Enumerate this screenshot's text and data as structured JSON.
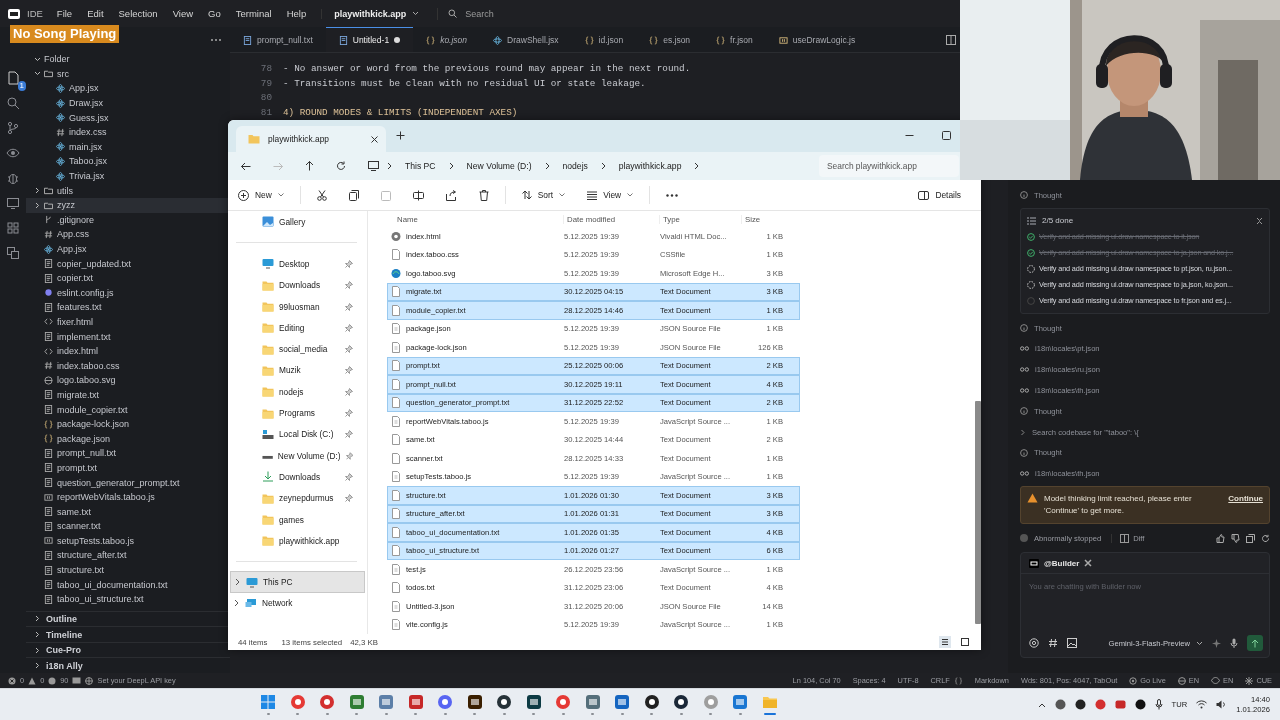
{
  "overlay": {
    "text": "No Song Playing"
  },
  "title_bar": {
    "app": "IDE",
    "menus": [
      "File",
      "Edit",
      "Selection",
      "View",
      "Go",
      "Terminal",
      "Help"
    ],
    "project": "playwithkick.app",
    "search": {
      "placeholder": "Search"
    }
  },
  "activity_bar": {
    "badge": "1"
  },
  "sidebar": {
    "tree": [
      {
        "label": "Folder",
        "kind": "root",
        "expanded": true,
        "selected": false,
        "children": [
          {
            "label": "src",
            "kind": "folder",
            "expanded": true,
            "selected": false,
            "children": [
              {
                "label": "App.jsx",
                "kind": "jsx",
                "selected": false
              },
              {
                "label": "Draw.jsx",
                "kind": "jsx",
                "selected": false
              },
              {
                "label": "Guess.jsx",
                "kind": "jsx",
                "selected": false
              },
              {
                "label": "index.css",
                "kind": "css",
                "selected": false
              },
              {
                "label": "main.jsx",
                "kind": "jsx",
                "selected": false
              },
              {
                "label": "Taboo.jsx",
                "kind": "jsx",
                "selected": false
              },
              {
                "label": "Trivia.jsx",
                "kind": "jsx",
                "selected": false
              }
            ]
          },
          {
            "label": "utils",
            "kind": "folder",
            "expanded": false,
            "selected": false
          },
          {
            "label": "zyzz",
            "kind": "folder",
            "expanded": false,
            "selected": true
          },
          {
            "label": ".gitignore",
            "kind": "git",
            "selected": false
          },
          {
            "label": "App.css",
            "kind": "css",
            "selected": false
          },
          {
            "label": "App.jsx",
            "kind": "jsx",
            "selected": false
          },
          {
            "label": "copier_updated.txt",
            "kind": "txt",
            "selected": false
          },
          {
            "label": "copier.txt",
            "kind": "txt",
            "selected": false
          },
          {
            "label": "eslint.config.js",
            "kind": "eslint",
            "selected": false
          },
          {
            "label": "features.txt",
            "kind": "txt",
            "selected": false
          },
          {
            "label": "fixer.html",
            "kind": "html",
            "selected": false
          },
          {
            "label": "implement.txt",
            "kind": "txt",
            "selected": false
          },
          {
            "label": "index.html",
            "kind": "html",
            "selected": false
          },
          {
            "label": "index.taboo.css",
            "kind": "css",
            "selected": false
          },
          {
            "label": "logo.taboo.svg",
            "kind": "svg",
            "selected": false
          },
          {
            "label": "migrate.txt",
            "kind": "txt",
            "selected": false
          },
          {
            "label": "module_copier.txt",
            "kind": "txt",
            "selected": false
          },
          {
            "label": "package-lock.json",
            "kind": "json",
            "selected": false
          },
          {
            "label": "package.json",
            "kind": "json",
            "selected": false
          },
          {
            "label": "prompt_null.txt",
            "kind": "txt",
            "selected": false
          },
          {
            "label": "prompt.txt",
            "kind": "txt",
            "selected": false
          },
          {
            "label": "question_generator_prompt.txt",
            "kind": "txt",
            "selected": false
          },
          {
            "label": "reportWebVitals.taboo.js",
            "kind": "js",
            "selected": false
          },
          {
            "label": "same.txt",
            "kind": "txt",
            "selected": false
          },
          {
            "label": "scanner.txt",
            "kind": "txt",
            "selected": false
          },
          {
            "label": "setupTests.taboo.js",
            "kind": "js",
            "selected": false
          },
          {
            "label": "structure_after.txt",
            "kind": "txt",
            "selected": false
          },
          {
            "label": "structure.txt",
            "kind": "txt",
            "selected": false
          },
          {
            "label": "taboo_ui_documentation.txt",
            "kind": "txt",
            "selected": false
          },
          {
            "label": "taboo_ui_structure.txt",
            "kind": "txt",
            "selected": false
          }
        ]
      }
    ],
    "sections": [
      "Outline",
      "Timeline",
      "Cue-Pro",
      "i18n Ally"
    ]
  },
  "editor": {
    "tabs": [
      {
        "label": "prompt_null.txt",
        "selected": false,
        "preview": false,
        "modified": false,
        "kind": "txt"
      },
      {
        "label": "Untitled-1",
        "selected": true,
        "preview": false,
        "modified": true,
        "kind": "txt"
      },
      {
        "label": "ko.json",
        "selected": false,
        "preview": true,
        "modified": false,
        "kind": "json"
      },
      {
        "label": "DrawShell.jsx",
        "selected": false,
        "preview": false,
        "modified": false,
        "kind": "jsx"
      },
      {
        "label": "id.json",
        "selected": false,
        "preview": false,
        "modified": false,
        "kind": "json"
      },
      {
        "label": "es.json",
        "selected": false,
        "preview": false,
        "modified": false,
        "kind": "json"
      },
      {
        "label": "fr.json",
        "selected": false,
        "preview": false,
        "modified": false,
        "kind": "json"
      },
      {
        "label": "useDrawLogic.js",
        "selected": false,
        "preview": false,
        "modified": false,
        "kind": "js"
      }
    ],
    "lines": [
      {
        "number": "78",
        "text": "- No answer or word from the previous round may appear in the next round.",
        "kind": "list"
      },
      {
        "number": "79",
        "text": "- Transitions must be clean with no residual UI or state leakage.",
        "kind": "list"
      },
      {
        "number": "80"
      },
      {
        "number": "81",
        "text": "4) ROUND MODES & LIMITS (INDEPENDENT AXES)",
        "kind": "heading"
      }
    ]
  },
  "explorer_window": {
    "tab_title": "playwithkick.app",
    "breadcrumb": [
      "This PC",
      "New Volume (D:)",
      "nodejs",
      "playwithkick.app"
    ],
    "search": {
      "placeholder": "Search playwithkick.app"
    },
    "toolbar": {
      "new": "New",
      "sort": "Sort",
      "view": "View",
      "details": "Details"
    },
    "nav_top": [
      {
        "label": "Gallery",
        "kind": "gallery",
        "pinned": false,
        "selected": false
      }
    ],
    "quick_access": [
      {
        "label": "Desktop",
        "kind": "desktop",
        "pinned": true,
        "selected": false
      },
      {
        "label": "Downloads",
        "kind": "folder",
        "pinned": true,
        "selected": false
      },
      {
        "label": "99luosman",
        "kind": "folder",
        "pinned": true,
        "selected": false
      },
      {
        "label": "Editing",
        "kind": "folder",
        "pinned": true,
        "selected": false
      },
      {
        "label": "social_media",
        "kind": "folder",
        "pinned": true,
        "selected": false
      },
      {
        "label": "Muzik",
        "kind": "folder",
        "pinned": true,
        "selected": false
      },
      {
        "label": "nodejs",
        "kind": "folder",
        "pinned": true,
        "selected": false
      },
      {
        "label": "Programs",
        "kind": "folder",
        "pinned": true,
        "selected": false
      },
      {
        "label": "Local Disk (C:)",
        "kind": "system_drive",
        "pinned": true,
        "selected": false
      },
      {
        "label": "New Volume (D:)",
        "kind": "drive",
        "pinned": true,
        "selected": false
      },
      {
        "label": "Downloads",
        "kind": "download",
        "pinned": true,
        "selected": false
      },
      {
        "label": "zeynepdurmus",
        "kind": "folder",
        "pinned": true,
        "selected": false
      },
      {
        "label": "games",
        "kind": "folder",
        "pinned": false,
        "selected": false
      },
      {
        "label": "playwithkick.app",
        "kind": "folder",
        "pinned": false,
        "selected": false
      }
    ],
    "locations": [
      {
        "label": "This PC",
        "kind": "pc",
        "pinned": false,
        "selected": true
      },
      {
        "label": "Network",
        "kind": "network",
        "pinned": false,
        "selected": false
      }
    ],
    "columns": [
      "Name",
      "Date modified",
      "Type",
      "Size"
    ],
    "rows": [
      {
        "name": "index.html",
        "date": "5.12.2025 19:39",
        "type": "Vivaldi HTML Doc...",
        "size": "1 KB",
        "kind": "html",
        "selected": false
      },
      {
        "name": "index.taboo.css",
        "date": "5.12.2025 19:39",
        "type": "CSSfile",
        "size": "1 KB",
        "kind": "plain",
        "selected": false
      },
      {
        "name": "logo.taboo.svg",
        "date": "5.12.2025 19:39",
        "type": "Microsoft Edge H...",
        "size": "3 KB",
        "kind": "svg",
        "selected": false
      },
      {
        "name": "migrate.txt",
        "date": "30.12.2025 04:15",
        "type": "Text Document",
        "size": "3 KB",
        "kind": "txt",
        "selected": true
      },
      {
        "name": "module_copier.txt",
        "date": "28.12.2025 14:46",
        "type": "Text Document",
        "size": "1 KB",
        "kind": "txt",
        "selected": true
      },
      {
        "name": "package.json",
        "date": "5.12.2025 19:39",
        "type": "JSON Source File",
        "size": "1 KB",
        "kind": "code",
        "selected": false
      },
      {
        "name": "package-lock.json",
        "date": "5.12.2025 19:39",
        "type": "JSON Source File",
        "size": "126 KB",
        "kind": "code",
        "selected": false
      },
      {
        "name": "prompt.txt",
        "date": "25.12.2025 00:06",
        "type": "Text Document",
        "size": "2 KB",
        "kind": "txt",
        "selected": true
      },
      {
        "name": "prompt_null.txt",
        "date": "30.12.2025 19:11",
        "type": "Text Document",
        "size": "4 KB",
        "kind": "txt",
        "selected": true
      },
      {
        "name": "question_generator_prompt.txt",
        "date": "31.12.2025 22:52",
        "type": "Text Document",
        "size": "2 KB",
        "kind": "txt",
        "selected": true
      },
      {
        "name": "reportWebVitals.taboo.js",
        "date": "5.12.2025 19:39",
        "type": "JavaScript Source ...",
        "size": "1 KB",
        "kind": "code",
        "selected": false
      },
      {
        "name": "same.txt",
        "date": "30.12.2025 14:44",
        "type": "Text Document",
        "size": "2 KB",
        "kind": "txt",
        "selected": false
      },
      {
        "name": "scanner.txt",
        "date": "28.12.2025 14:33",
        "type": "Text Document",
        "size": "1 KB",
        "kind": "txt",
        "selected": false
      },
      {
        "name": "setupTests.taboo.js",
        "date": "5.12.2025 19:39",
        "type": "JavaScript Source ...",
        "size": "1 KB",
        "kind": "code",
        "selected": false
      },
      {
        "name": "structure.txt",
        "date": "1.01.2026 01:30",
        "type": "Text Document",
        "size": "3 KB",
        "kind": "txt",
        "selected": true
      },
      {
        "name": "structure_after.txt",
        "date": "1.01.2026 01:31",
        "type": "Text Document",
        "size": "3 KB",
        "kind": "txt",
        "selected": true
      },
      {
        "name": "taboo_ui_documentation.txt",
        "date": "1.01.2026 01:35",
        "type": "Text Document",
        "size": "4 KB",
        "kind": "txt",
        "selected": true
      },
      {
        "name": "taboo_ui_structure.txt",
        "date": "1.01.2026 01:27",
        "type": "Text Document",
        "size": "6 KB",
        "kind": "txt",
        "selected": true
      },
      {
        "name": "test.js",
        "date": "26.12.2025 23:56",
        "type": "JavaScript Source ...",
        "size": "1 KB",
        "kind": "code",
        "selected": false
      },
      {
        "name": "todos.txt",
        "date": "31.12.2025 23:06",
        "type": "Text Document",
        "size": "4 KB",
        "kind": "txt",
        "selected": false
      },
      {
        "name": "Untitled-3.json",
        "date": "31.12.2025 20:06",
        "type": "JSON Source File",
        "size": "14 KB",
        "kind": "code",
        "selected": false
      },
      {
        "name": "vite.config.js",
        "date": "5.12.2025 19:39",
        "type": "JavaScript Source ...",
        "size": "1 KB",
        "kind": "code",
        "selected": false
      }
    ],
    "status": {
      "count": "44 items",
      "selection": "13 items selected",
      "size": "42,3 KB"
    }
  },
  "chat": {
    "items": [
      {
        "kind": "thought",
        "text": "Thought"
      },
      {
        "kind": "todo",
        "title": "2/5 done",
        "tasks": [
          {
            "text": "Verify and add missing ui.draw namespace to it.json",
            "done": true
          },
          {
            "text": "Verify and add missing ui.draw namespace to ja.json and ko.j...",
            "done": true
          },
          {
            "text": "Verify and add missing ui.draw namespace to pt.json, ru.json...",
            "done": false,
            "running": true
          },
          {
            "text": "Verify and add missing ui.draw namespace to ja.json, ko.json...",
            "done": false,
            "running": true
          },
          {
            "text": "Verify and add missing ui.draw namespace to fr.json and es.j...",
            "done": false,
            "running": false
          }
        ]
      },
      {
        "kind": "thought",
        "text": "Thought"
      },
      {
        "kind": "read",
        "text": "i18n\\locales\\pt.json"
      },
      {
        "kind": "read",
        "text": "i18n\\locales\\ru.json"
      },
      {
        "kind": "read",
        "text": "i18n\\locales\\th.json"
      },
      {
        "kind": "thought",
        "text": "Thought"
      },
      {
        "kind": "search",
        "text": "Search codebase for '\"taboo\": \\{"
      },
      {
        "kind": "thought",
        "text": "Thought"
      },
      {
        "kind": "read",
        "text": "i18n\\locales\\th.json"
      }
    ],
    "warning": {
      "text": "Model thinking limit reached, please enter 'Continue' to get more.",
      "action": "Continue"
    },
    "footer": {
      "status": "Abnormally stopped",
      "diff": "Diff"
    },
    "composer": {
      "agent": "@Builder",
      "placeholder": "You are chatting with Builder now",
      "model": "Gemini-3-Flash-Preview"
    }
  },
  "status_bar": {
    "errors": "0",
    "warnings": "0",
    "infos": "90",
    "deepl": "Set your DeepL API key",
    "right": [
      {
        "text": "Ln 104, Col 70",
        "kind": "text"
      },
      {
        "text": "Spaces: 4",
        "kind": "text"
      },
      {
        "text": "UTF-8",
        "kind": "text"
      },
      {
        "text": "CRLF",
        "kind": "text"
      },
      {
        "kind": "braces"
      },
      {
        "text": "Markdown",
        "kind": "text"
      },
      {
        "text": "Wds: 801, Pos: 4047, TabOut",
        "kind": "text"
      },
      {
        "text": "Go Live",
        "kind": "live"
      },
      {
        "text": "EN",
        "kind": "globe"
      },
      {
        "text": "EN",
        "kind": "eye"
      },
      {
        "text": "CUE",
        "kind": "star"
      }
    ]
  },
  "taskbar": {
    "apps": [
      {
        "active": false
      },
      {
        "active": false
      },
      {
        "active": false
      },
      {
        "active": false
      },
      {
        "active": false
      },
      {
        "active": false
      },
      {
        "active": false
      },
      {
        "active": false
      },
      {
        "active": false
      },
      {
        "active": false
      },
      {
        "active": false
      },
      {
        "active": false
      },
      {
        "active": false
      },
      {
        "active": false
      },
      {
        "active": false
      },
      {
        "active": false
      },
      {
        "active": false
      },
      {
        "active": true
      }
    ],
    "language": "TUR",
    "time": "14:40",
    "date": "1.01.2026"
  }
}
